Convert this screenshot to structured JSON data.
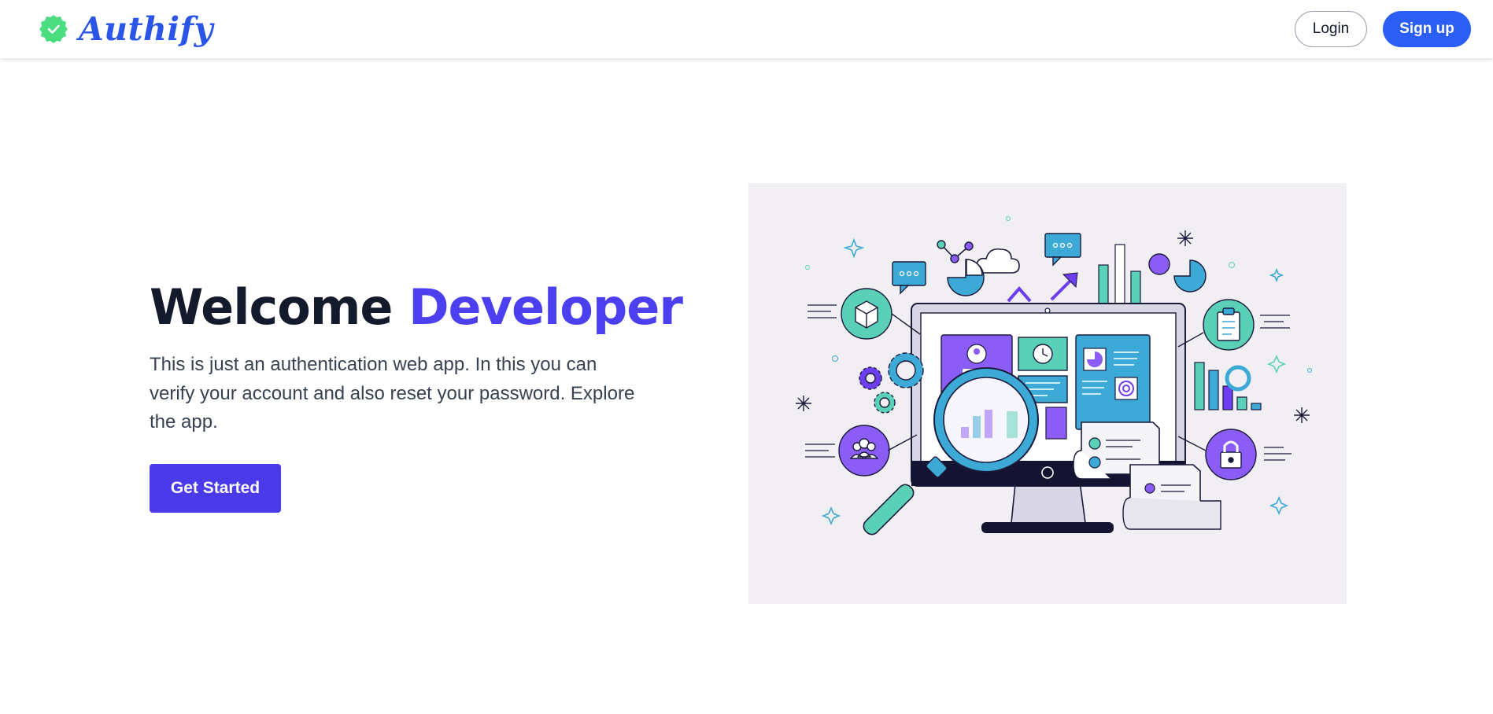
{
  "navbar": {
    "brand": "Authify",
    "brand_icon": "verified-badge-icon",
    "login_label": "Login",
    "signup_label": "Sign up"
  },
  "hero": {
    "title_part1": "Welcome",
    "title_part2": "Developer",
    "description": "This is just an authentication web app. In this you can verify your account and also reset your password. Explore the app.",
    "cta_label": "Get Started"
  },
  "illustration": {
    "icons": [
      "monitor-icon",
      "magnifier-icon",
      "gear-icon",
      "users-icon",
      "lock-icon",
      "clipboard-icon",
      "box-icon",
      "cloud-icon",
      "bar-chart-icon",
      "pie-chart-icon",
      "chat-bubble-icon"
    ]
  },
  "colors": {
    "brand_blue": "#2b55e6",
    "accent_purple": "#4b3ff0",
    "cta_purple": "#4b3aea",
    "signup_blue": "#2b5ef5",
    "badge_green": "#4ade80",
    "illustration_bg": "#f1eff4"
  }
}
